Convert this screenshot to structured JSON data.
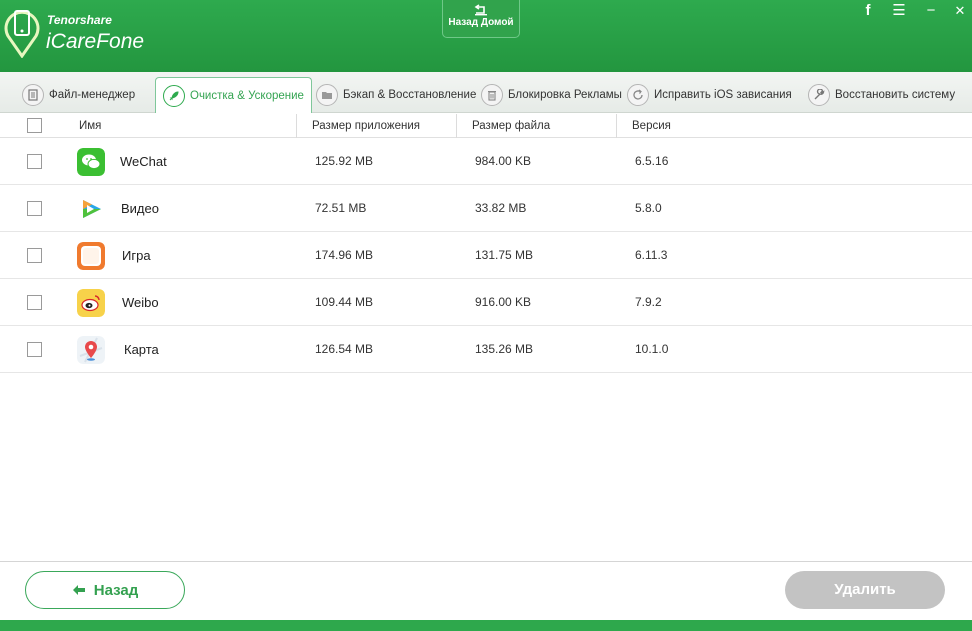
{
  "app": {
    "brand_small": "Tenorshare",
    "brand_big": "iCareFone",
    "home_label": "Назад Домой"
  },
  "window_controls": {
    "facebook": "f",
    "menu": "☰",
    "minimize": "−",
    "close": "✕"
  },
  "tabs": [
    {
      "label": "Файл-менеджер",
      "icon": "file-icon"
    },
    {
      "label": "Очистка & Ускорение",
      "icon": "rocket-icon",
      "active": true
    },
    {
      "label": "Бэкап & Восстановление",
      "icon": "folder-icon"
    },
    {
      "label": "Блокировка Рекламы",
      "icon": "trash-icon"
    },
    {
      "label": "Исправить iOS зависания",
      "icon": "refresh-icon"
    },
    {
      "label": "Восстановить систему",
      "icon": "wrench-icon"
    }
  ],
  "table": {
    "headers": {
      "name": "Имя",
      "app_size": "Размер приложения",
      "file_size": "Размер файла",
      "version": "Версия"
    },
    "rows": [
      {
        "name": "WeChat",
        "app_size": "125.92 MB",
        "file_size": "984.00 KB",
        "version": "6.5.16",
        "icon": "wechat-icon"
      },
      {
        "name": "Видео",
        "app_size": "72.51 MB",
        "file_size": "33.82 MB",
        "version": "5.8.0",
        "icon": "video-icon"
      },
      {
        "name": "Игра",
        "app_size": "174.96 MB",
        "file_size": "131.75 MB",
        "version": "6.11.3",
        "icon": "game-icon"
      },
      {
        "name": "Weibo",
        "app_size": "109.44 MB",
        "file_size": "916.00 KB",
        "version": "7.9.2",
        "icon": "weibo-icon"
      },
      {
        "name": "Карта",
        "app_size": "126.54 MB",
        "file_size": "135.26 MB",
        "version": "10.1.0",
        "icon": "map-icon"
      }
    ]
  },
  "footer": {
    "back_label": "Назад",
    "delete_label": "Удалить"
  },
  "colors": {
    "accent": "#2eaa4e",
    "disabled": "#c3c3c3"
  }
}
